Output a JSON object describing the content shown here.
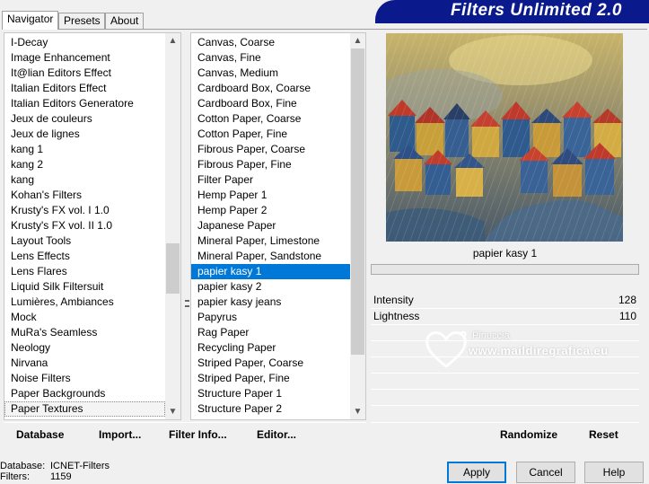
{
  "banner": {
    "title": "Filters Unlimited 2.0"
  },
  "tabs": [
    {
      "label": "Navigator"
    },
    {
      "label": "Presets"
    },
    {
      "label": "About"
    }
  ],
  "categories": [
    "I-Decay",
    "Image Enhancement",
    "It@lian Editors Effect",
    "Italian Editors Effect",
    "Italian Editors Generatore",
    "Jeux de couleurs",
    "Jeux de lignes",
    "kang 1",
    "kang 2",
    "kang",
    "Kohan's Filters",
    "Krusty's FX vol. I 1.0",
    "Krusty's FX vol. II 1.0",
    "Layout Tools",
    "Lens Effects",
    "Lens Flares",
    "Liquid Silk Filtersuit",
    "Lumières, Ambiances",
    "Mock",
    "MuRa's Seamless",
    "Neology",
    "Nirvana",
    "Noise Filters",
    "Paper Backgrounds",
    "Paper Textures"
  ],
  "selected_category": "Paper Textures",
  "filters": [
    "Canvas, Coarse",
    "Canvas, Fine",
    "Canvas, Medium",
    "Cardboard Box, Coarse",
    "Cardboard Box, Fine",
    "Cotton Paper, Coarse",
    "Cotton Paper, Fine",
    "Fibrous Paper, Coarse",
    "Fibrous Paper, Fine",
    "Filter Paper",
    "Hemp Paper 1",
    "Hemp Paper 2",
    "Japanese Paper",
    "Mineral Paper, Limestone",
    "Mineral Paper, Sandstone",
    "papier kasy 1",
    "papier kasy 2",
    "papier kasy jeans",
    "Papyrus",
    "Rag Paper",
    "Recycling Paper",
    "Striped Paper, Coarse",
    "Striped Paper, Fine",
    "Structure Paper 1",
    "Structure Paper 2"
  ],
  "selected_filter": "papier kasy 1",
  "preview": {
    "filter_name": "papier kasy 1"
  },
  "sliders": [
    {
      "label": "Intensity",
      "value": "128"
    },
    {
      "label": "Lightness",
      "value": "110"
    }
  ],
  "watermark": {
    "brand": "Pinuccia",
    "site": "www.maildiregrafica.eu"
  },
  "left_buttons": {
    "database": "Database",
    "import": "Import...",
    "filter_info": "Filter Info...",
    "editor": "Editor..."
  },
  "right_buttons": {
    "randomize": "Randomize",
    "reset": "Reset"
  },
  "status": {
    "database_label": "Database:",
    "database_value": "ICNET-Filters",
    "filters_label": "Filters:",
    "filters_value": "1159"
  },
  "dialog_buttons": {
    "apply": "Apply",
    "cancel": "Cancel",
    "help": "Help"
  }
}
